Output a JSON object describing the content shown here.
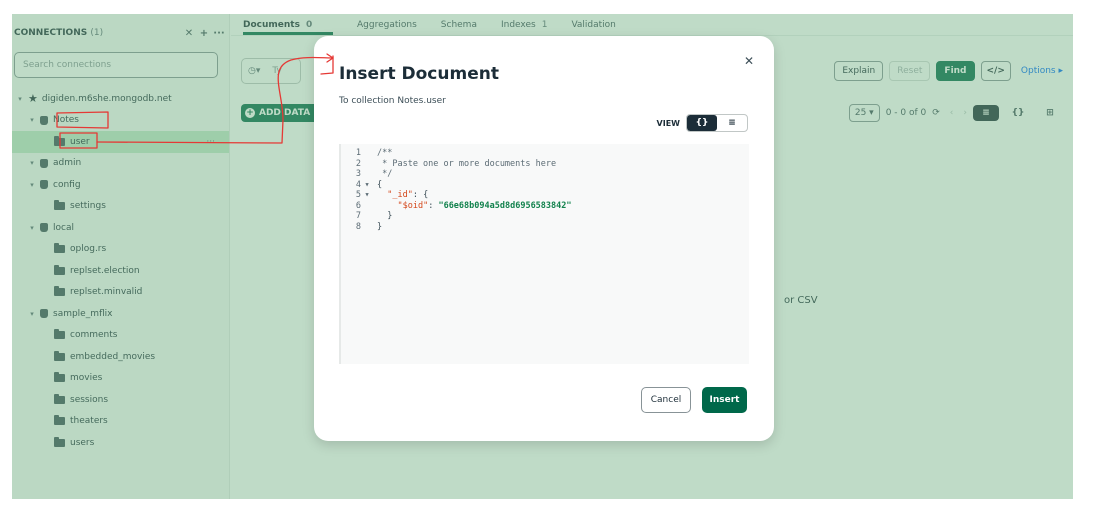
{
  "sidebar": {
    "title": "CONNECTIONS",
    "count": "(1)",
    "search_placeholder": "Search connections",
    "tree": [
      {
        "label": "digiden.m6she.mongodb.net",
        "kind": "connection",
        "level": 0
      },
      {
        "label": "Notes",
        "kind": "database",
        "level": 1
      },
      {
        "label": "user",
        "kind": "collection",
        "level": 2,
        "active": true
      },
      {
        "label": "admin",
        "kind": "database",
        "level": 1
      },
      {
        "label": "config",
        "kind": "database",
        "level": 1
      },
      {
        "label": "settings",
        "kind": "collection",
        "level": 2
      },
      {
        "label": "local",
        "kind": "database",
        "level": 1
      },
      {
        "label": "oplog.rs",
        "kind": "collection",
        "level": 2
      },
      {
        "label": "replset.election",
        "kind": "collection",
        "level": 2
      },
      {
        "label": "replset.minvalid",
        "kind": "collection",
        "level": 2
      },
      {
        "label": "sample_mflix",
        "kind": "database",
        "level": 1
      },
      {
        "label": "comments",
        "kind": "collection",
        "level": 2
      },
      {
        "label": "embedded_movies",
        "kind": "collection",
        "level": 2
      },
      {
        "label": "movies",
        "kind": "collection",
        "level": 2
      },
      {
        "label": "sessions",
        "kind": "collection",
        "level": 2
      },
      {
        "label": "theaters",
        "kind": "collection",
        "level": 2
      },
      {
        "label": "users",
        "kind": "collection",
        "level": 2
      }
    ]
  },
  "tabs": [
    {
      "label": "Documents",
      "count": "0",
      "active": true
    },
    {
      "label": "Aggregations",
      "count": ""
    },
    {
      "label": "Schema",
      "count": ""
    },
    {
      "label": "Indexes",
      "count": "1"
    },
    {
      "label": "Validation",
      "count": ""
    }
  ],
  "query": {
    "placeholder": "Ty",
    "explain": "Explain",
    "reset": "Reset",
    "find": "Find",
    "code_icon": "</>",
    "options": "Options ▸"
  },
  "toolbar": {
    "add_data": "ADD DATA",
    "page_size": "25 ▾",
    "range": "0 - 0 of 0"
  },
  "empty_state_fragment": "or CSV",
  "modal": {
    "title": "Insert Document",
    "subtitle": "To collection Notes.user",
    "view_label": "VIEW",
    "json_view": "{}",
    "list_view": "≡",
    "cancel": "Cancel",
    "insert": "Insert",
    "code_lines": [
      {
        "n": "1",
        "fold": "",
        "parts": [
          {
            "t": "/**",
            "c": "ct"
          }
        ]
      },
      {
        "n": "2",
        "fold": "",
        "parts": [
          {
            "t": " * Paste one or more documents here",
            "c": "ct"
          }
        ]
      },
      {
        "n": "3",
        "fold": "",
        "parts": [
          {
            "t": " */",
            "c": "ct"
          }
        ]
      },
      {
        "n": "4",
        "fold": "▾",
        "parts": [
          {
            "t": "{",
            "c": "punct"
          }
        ]
      },
      {
        "n": "5",
        "fold": "▾",
        "parts": [
          {
            "t": "  ",
            "c": "punct"
          },
          {
            "t": "\"_id\"",
            "c": "key"
          },
          {
            "t": ": {",
            "c": "punct"
          }
        ]
      },
      {
        "n": "6",
        "fold": "",
        "parts": [
          {
            "t": "    ",
            "c": "punct"
          },
          {
            "t": "\"$oid\"",
            "c": "key"
          },
          {
            "t": ": ",
            "c": "punct"
          },
          {
            "t": "\"66e68b094a5d8d6956583842\"",
            "c": "str"
          }
        ]
      },
      {
        "n": "7",
        "fold": "",
        "parts": [
          {
            "t": "  }",
            "c": "punct"
          }
        ]
      },
      {
        "n": "8",
        "fold": "",
        "parts": [
          {
            "t": "}",
            "c": "punct"
          }
        ]
      }
    ]
  },
  "colors": {
    "accent": "#00684a",
    "sidebar_active": "#c3e7ca",
    "annotation": "#e53935"
  }
}
